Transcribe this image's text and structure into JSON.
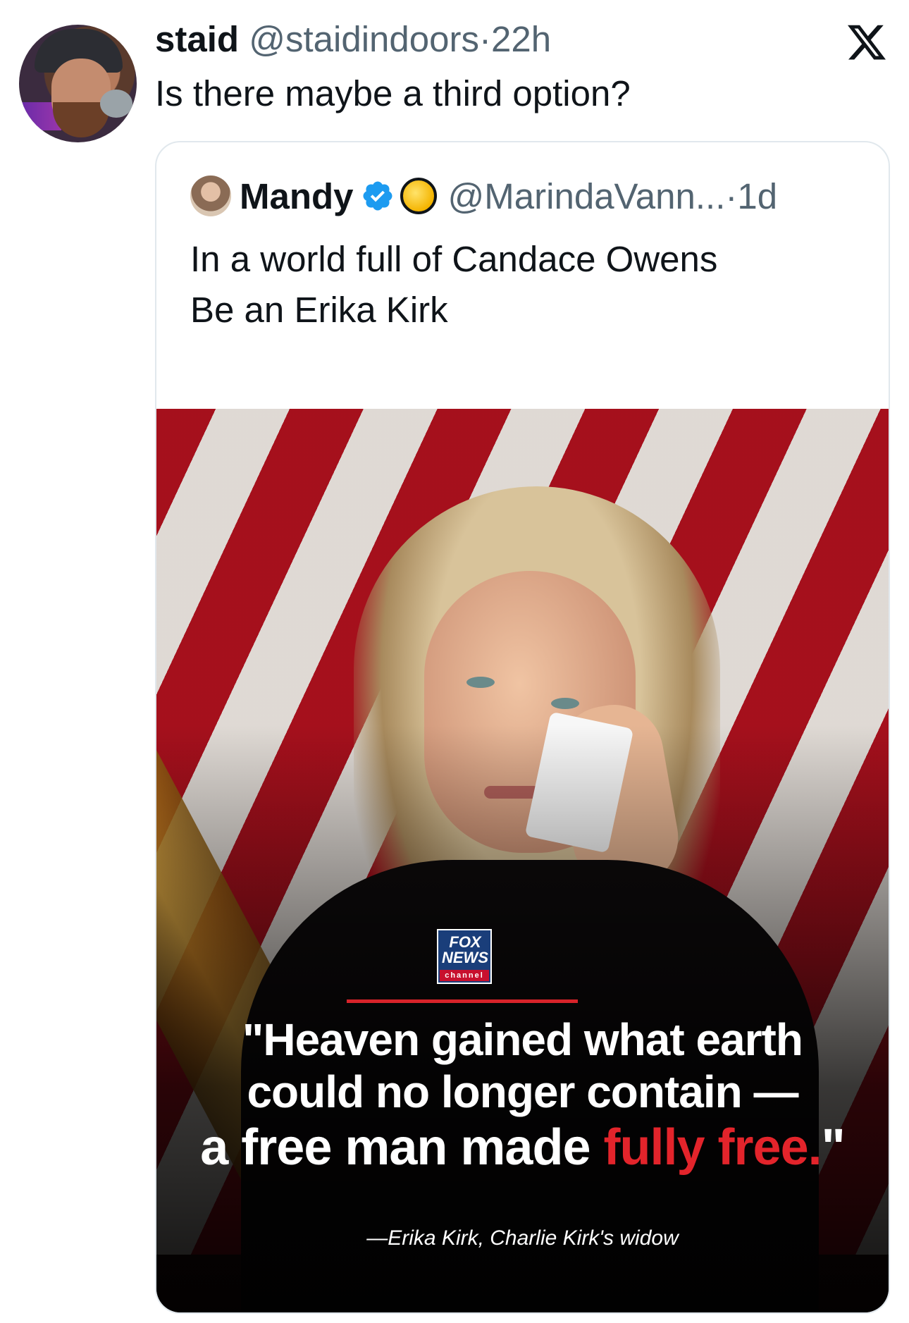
{
  "post": {
    "author_name": "staid",
    "author_handle": "@staidindoors",
    "separator": "·",
    "time": "22h",
    "text": "Is there maybe a third option?",
    "platform_icon": "x-logo"
  },
  "quoted_post": {
    "author_name": "Mandy",
    "verified": true,
    "badge_icon": "yellow-circle-emoji",
    "author_handle": "@MarindaVann...",
    "separator": "·",
    "time": "1d",
    "text_line_1": "In a world full of Candace Owens",
    "text_line_2": "Be an Erika Kirk",
    "media": {
      "description_icon": "photo",
      "logo": {
        "line1": "FOX",
        "line2": "NEWS",
        "line3": "channel"
      },
      "quote_line_1": "\"Heaven gained what earth",
      "quote_line_2": "could no longer contain —",
      "quote_line_3_white": "a free man made ",
      "quote_line_3_red": "fully free.",
      "quote_line_3_end": "\"",
      "attribution": "—Erika Kirk, Charlie Kirk's widow",
      "accent_color": "#e3242b"
    }
  }
}
